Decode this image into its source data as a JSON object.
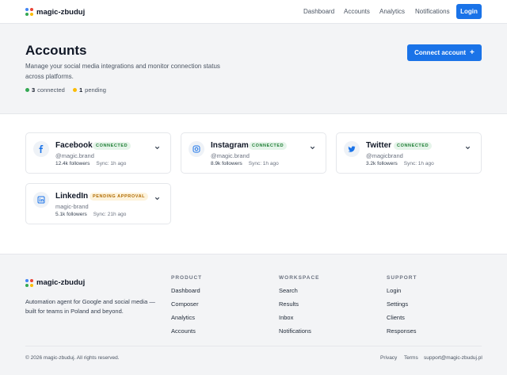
{
  "app": {
    "name": "magic-zbuduj",
    "logo_colors": [
      "#4285f4",
      "#ea4335",
      "#34a853",
      "#fbbc05"
    ]
  },
  "nav": {
    "items": [
      "Dashboard",
      "Accounts",
      "Analytics",
      "Notifications"
    ],
    "login": "Login"
  },
  "hero": {
    "title": "Accounts",
    "description": "Manage your social media integrations and monitor connection status across platforms.",
    "connected_count": "3",
    "connected_label": "connected",
    "pending_count": "1",
    "pending_label": "pending",
    "connect_button": "Connect account",
    "connected_color": "#34a853",
    "pending_color": "#fbbc05"
  },
  "accounts": [
    {
      "name": "Facebook",
      "status": "CONNECTED",
      "handle": "@magic.brand",
      "followers": "12.4k followers",
      "sync": "Sync: 1h ago",
      "icon": "facebook-icon"
    },
    {
      "name": "Instagram",
      "status": "CONNECTED",
      "handle": "@magic.brand",
      "followers": "8.9k followers",
      "sync": "Sync: 1h ago",
      "icon": "instagram-icon"
    },
    {
      "name": "Twitter",
      "status": "CONNECTED",
      "handle": "@magicbrand",
      "followers": "3.2k followers",
      "sync": "Sync: 1h ago",
      "icon": "twitter-icon"
    },
    {
      "name": "LinkedIn",
      "status": "PENDING APPROVAL",
      "handle": "magic-brand",
      "followers": "5.1k followers",
      "sync": "Sync: 21h ago",
      "icon": "linkedin-icon"
    }
  ],
  "footer": {
    "tagline": "Automation agent for Google and social media — built for teams in Poland and beyond.",
    "columns": [
      {
        "title": "PRODUCT",
        "links": [
          "Dashboard",
          "Composer",
          "Analytics",
          "Accounts"
        ]
      },
      {
        "title": "WORKSPACE",
        "links": [
          "Search",
          "Results",
          "Inbox",
          "Notifications"
        ]
      },
      {
        "title": "SUPPORT",
        "links": [
          "Login",
          "Settings",
          "Clients",
          "Responses"
        ]
      }
    ],
    "copyright": "© 2026 magic-zbuduj. All rights reserved.",
    "privacy": "Privacy",
    "terms": "Terms",
    "email": "support@magic-zbuduj.pl"
  }
}
